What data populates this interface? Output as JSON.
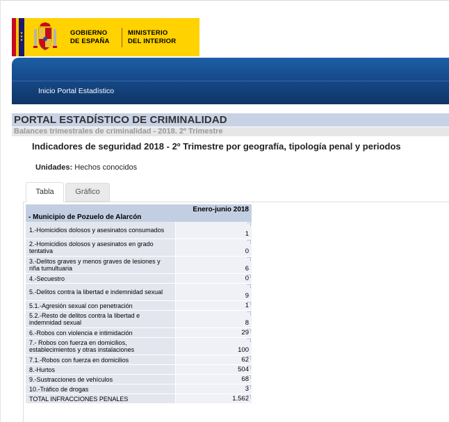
{
  "gov": {
    "line1a": "GOBIERNO",
    "line1b": "DE ESPAÑA",
    "line2a": "MINISTERIO",
    "line2b": "DEL INTERIOR"
  },
  "nav": {
    "home_link": "Inicio Portal Estadístico"
  },
  "portal": {
    "title": "PORTAL ESTADÍSTICO DE CRIMINALIDAD",
    "subtitle": "Balances trimestrales de criminalidad - 2018. 2º Trimestre"
  },
  "report": {
    "heading": "Indicadores de seguridad 2018 - 2º Trimestre por geografía, tipología penal y periodos",
    "units_label": "Unidades:",
    "units_value": "Hechos conocidos"
  },
  "tabs": [
    {
      "label": "Tabla",
      "active": true
    },
    {
      "label": "Gráfico",
      "active": false
    }
  ],
  "table": {
    "row_header": "- Municipio de Pozuelo de Alarcón",
    "column_header": "Enero-junio 2018",
    "rows": [
      {
        "label": "1.-Homicidios dolosos y asesinatos consumados",
        "value": "1"
      },
      {
        "label": "2.-Homicidios dolosos y asesinatos en grado tentativa",
        "value": "0"
      },
      {
        "label": "3.-Delitos graves y menos graves de lesiones y riña tumultuaria",
        "value": "6"
      },
      {
        "label": "4.-Secuestro",
        "value": "0"
      },
      {
        "label": "5.-Delitos contra la libertad e indemnidad sexual",
        "value": "9"
      },
      {
        "label": "5.1.-Agresión sexual con penetración",
        "value": "1"
      },
      {
        "label": "5.2.-Resto de delitos contra la libertad e indemnidad sexual",
        "value": "8"
      },
      {
        "label": "6.-Robos con violencia e intimidación",
        "value": "29"
      },
      {
        "label": "7.- Robos con fuerza en domicilios, establecimientos y otras instalaciones",
        "value": "100"
      },
      {
        "label": "7.1.-Robos con fuerza en domicilios",
        "value": "62"
      },
      {
        "label": "8.-Hurtos",
        "value": "504"
      },
      {
        "label": "9.-Sustracciones de vehículos",
        "value": "68"
      },
      {
        "label": "10.-Tráfico de drogas",
        "value": "3"
      },
      {
        "label": "TOTAL INFRACCIONES PENALES",
        "value": "1.562"
      }
    ]
  },
  "colors": {
    "gov_yellow": "#ffd200",
    "banner_blue": "#164b8c",
    "title_band": "#c7d2e5",
    "table_header": "#c2cfe2"
  }
}
